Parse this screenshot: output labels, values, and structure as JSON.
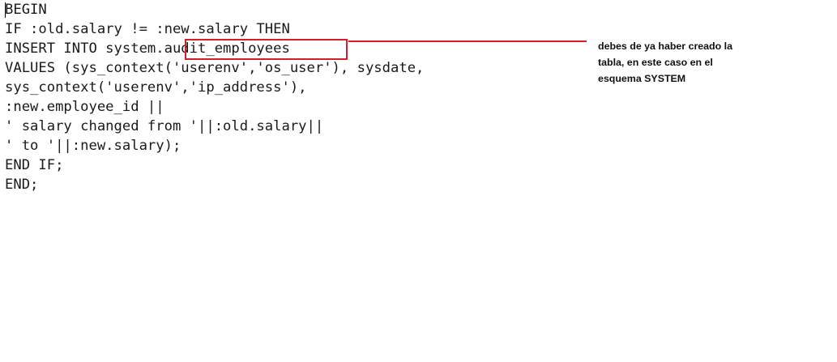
{
  "editor": {
    "lines": [
      "BEGIN",
      "IF :old.salary != :new.salary THEN",
      "INSERT INTO system.audit_employees",
      "VALUES (sys_context('userenv','os_user'), sysdate,",
      "sys_context('userenv','ip_address'),",
      ":new.employee_id ||",
      "' salary changed from '||:old.salary||",
      "' to '||:new.salary);",
      "END IF;",
      "END;"
    ]
  },
  "annotation": {
    "lines": [
      "debes de ya haber creado la",
      "tabla, en este caso en el",
      "esquema SYSTEM"
    ]
  },
  "colors": {
    "highlight": "#d1202c",
    "code_text": "#1a1a1a"
  }
}
